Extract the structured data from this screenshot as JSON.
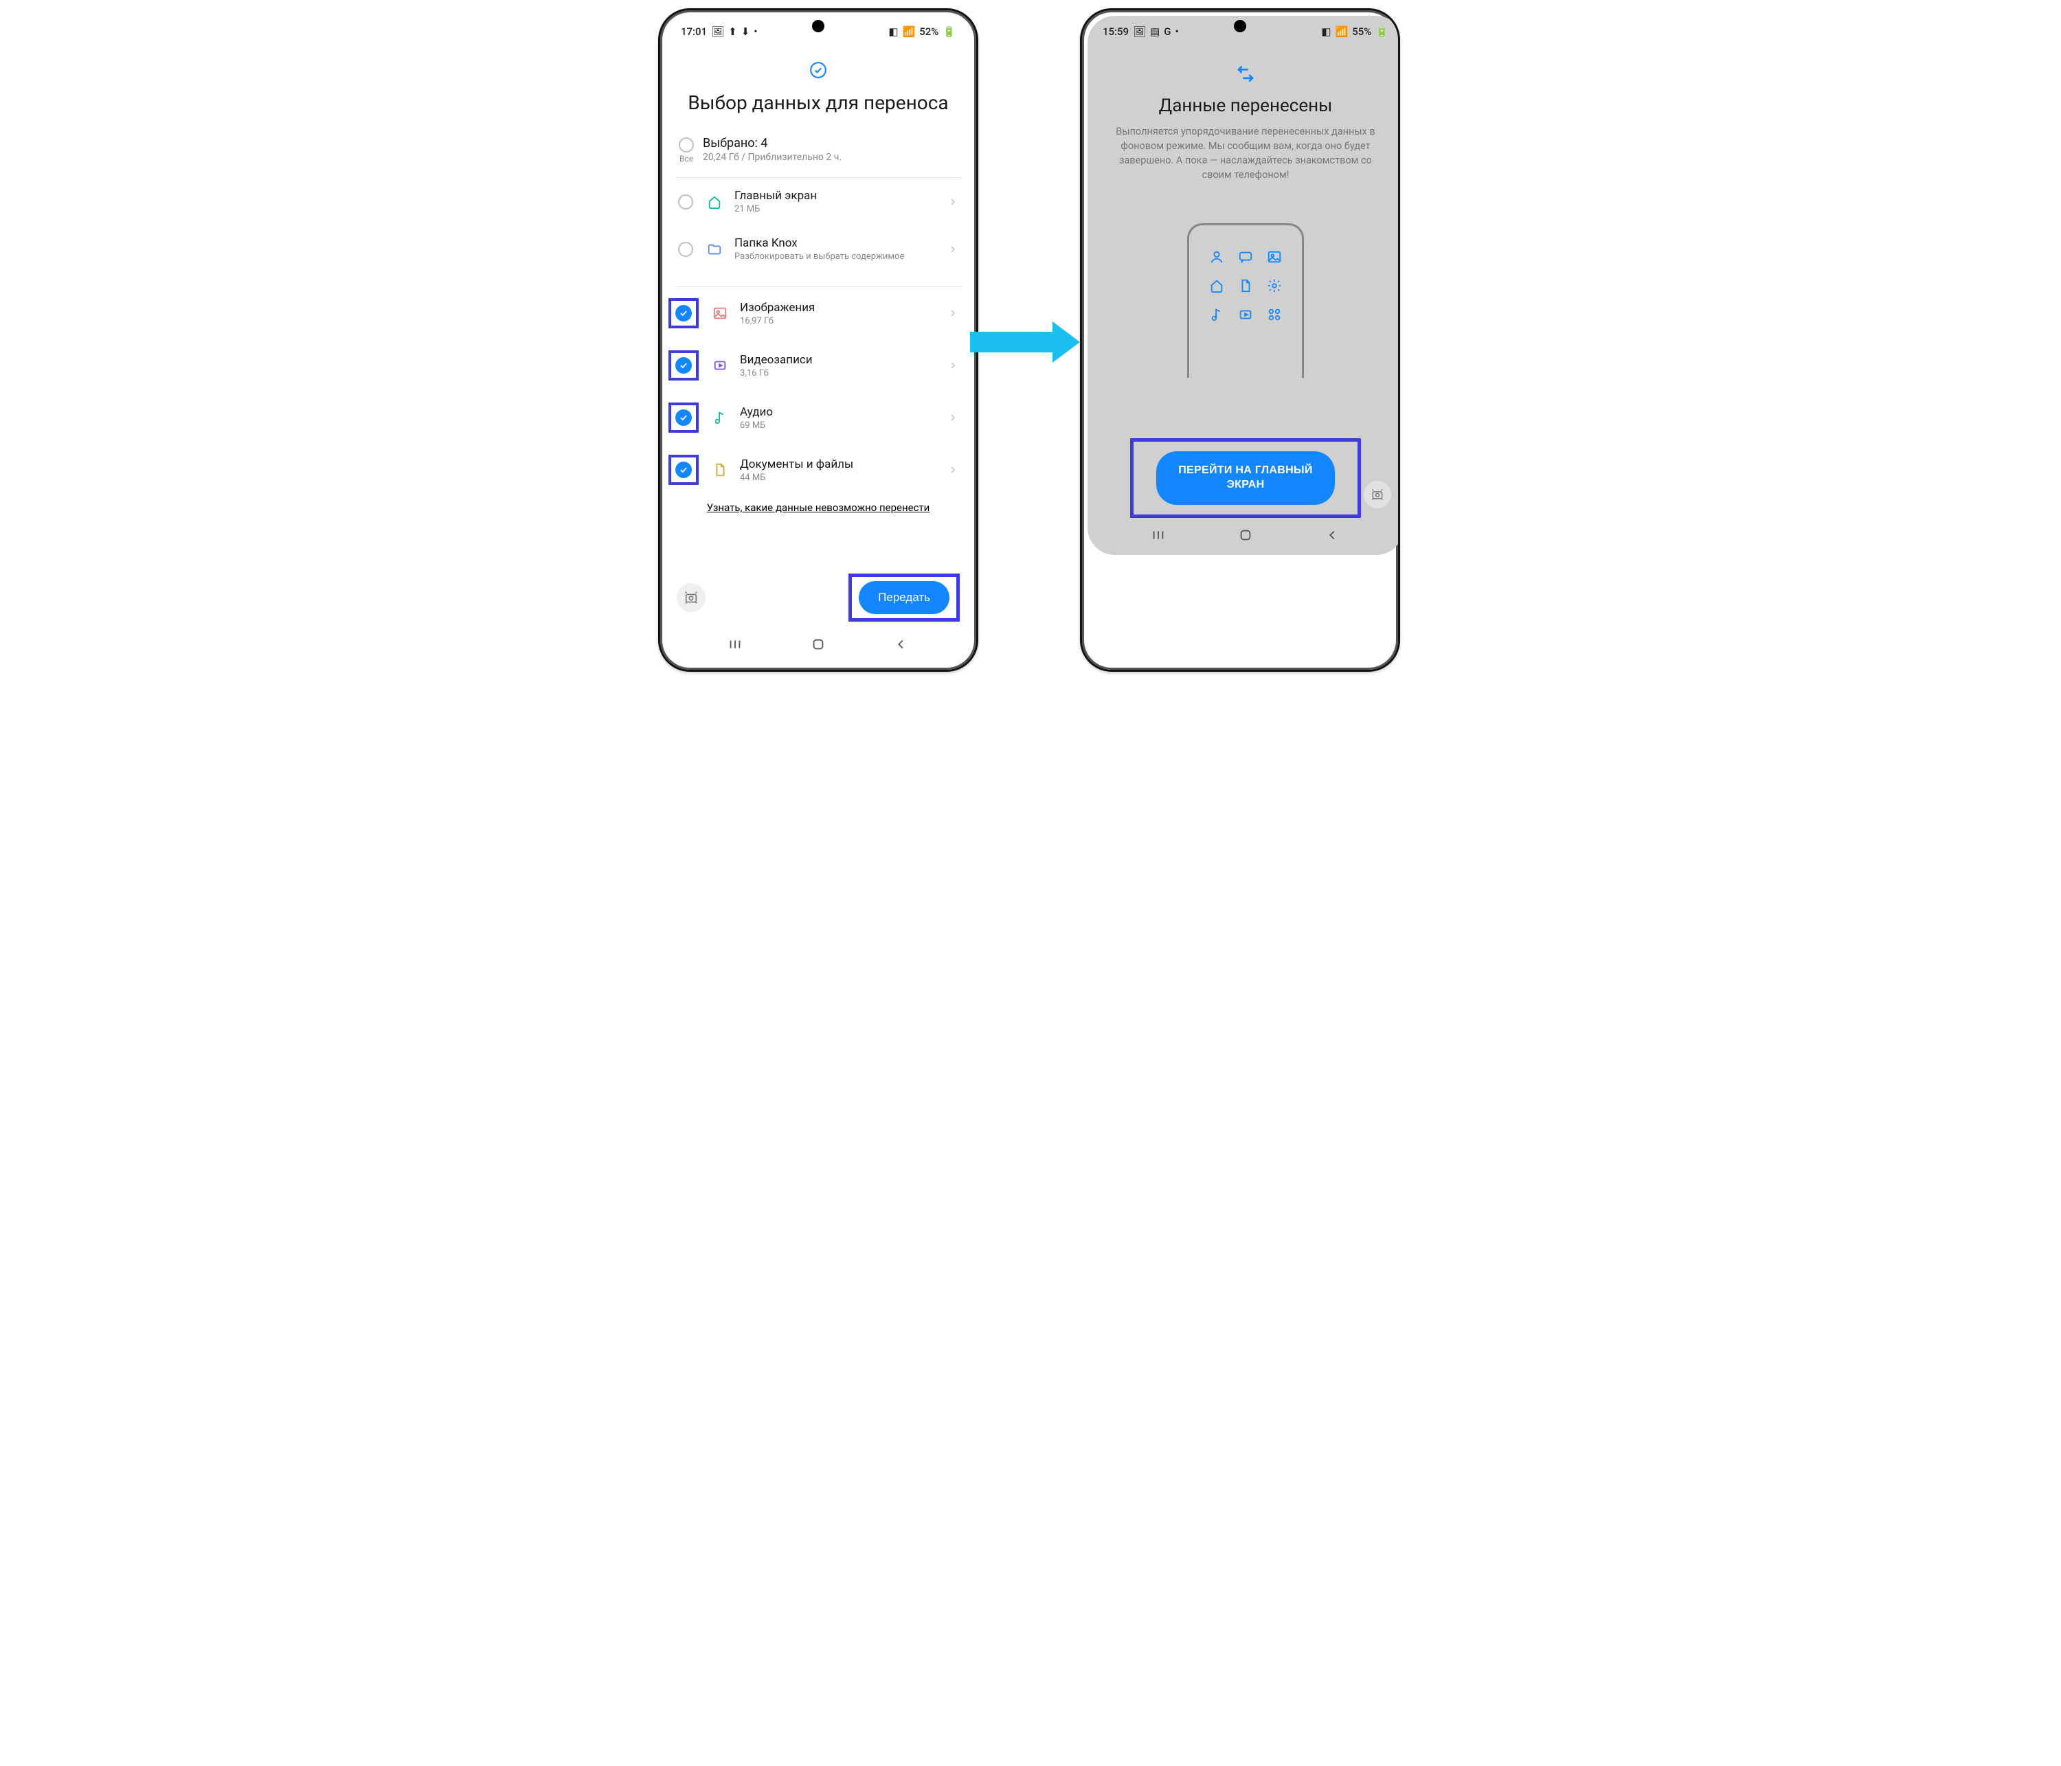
{
  "left": {
    "status": {
      "time": "17:01",
      "battery_label": "52%"
    },
    "title": "Выбор данных для переноса",
    "summary": {
      "all_label": "Все",
      "selected_label": "Выбрано: 4",
      "details": "20,24 Гб / Приблизительно 2 ч."
    },
    "items": [
      {
        "title": "Главный экран",
        "sub": "21 МБ",
        "checked": false,
        "highlight": false,
        "icon": "home"
      },
      {
        "title": "Папка Knox",
        "sub": "Разблокировать и выбрать содержимое",
        "checked": false,
        "highlight": false,
        "icon": "folder"
      },
      {
        "title": "Изображения",
        "sub": "16,97 Гб",
        "checked": true,
        "highlight": true,
        "icon": "image"
      },
      {
        "title": "Видеозаписи",
        "sub": "3,16 Гб",
        "checked": true,
        "highlight": true,
        "icon": "video"
      },
      {
        "title": "Аудио",
        "sub": "69 МБ",
        "checked": true,
        "highlight": true,
        "icon": "audio"
      },
      {
        "title": "Документы и файлы",
        "sub": "44 МБ",
        "checked": true,
        "highlight": true,
        "icon": "doc"
      }
    ],
    "info_link": "Узнать, какие данные невозможно перенести",
    "send_label": "Передать"
  },
  "right": {
    "status": {
      "time": "15:59",
      "battery_label": "55%"
    },
    "title": "Данные перенесены",
    "description": "Выполняется упорядочивание перенесенных данных в фоновом режиме. Мы сообщим вам, когда оно будет завершено. А пока — наслаждайтесь знакомством со своим телефоном!",
    "button_label": "ПЕРЕЙТИ НА ГЛАВНЫЙ ЭКРАН"
  }
}
